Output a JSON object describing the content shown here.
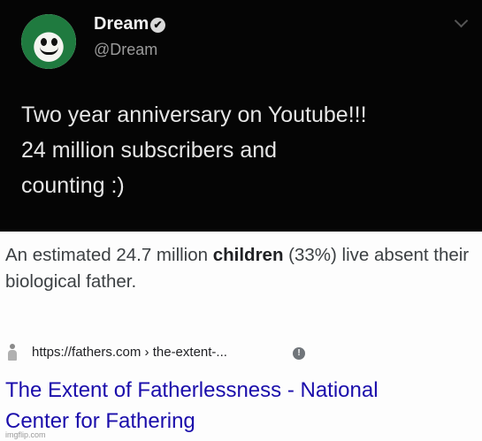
{
  "tweet": {
    "display_name": "Dream",
    "verified_icon": "✔",
    "handle": "@Dream",
    "lines": [
      "Two year anniversary on Youtube!!!",
      "24 million subscribers and",
      "counting :)"
    ]
  },
  "result": {
    "snippet_before": "An estimated 24.7 million ",
    "snippet_bold": "children",
    "snippet_after": " (33%) live absent their biological father.",
    "url": "https://fathers.com › the-extent-...",
    "info_icon": "!",
    "title_lines": [
      "The Extent of Fatherlessness - National",
      "Center for Fathering"
    ],
    "link_color": "#1a0dab"
  },
  "watermark": "imgflip.com"
}
